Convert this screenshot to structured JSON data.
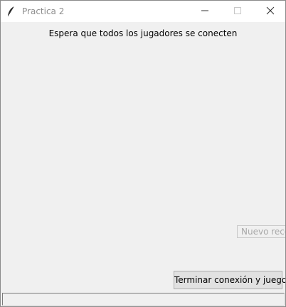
{
  "window": {
    "title": "Practica 2",
    "icons": {
      "app": "feather-icon",
      "minimize": "minimize-icon",
      "maximize": "maximize-icon",
      "close": "close-icon"
    }
  },
  "main": {
    "status_text": "Espera que todos los jugadores se conecten",
    "record_input_placeholder": "Nuevo recor",
    "end_button_label": "Terminar conexión y juego",
    "bottom_input_value": ""
  },
  "colors": {
    "background": "#f0f0f0",
    "titlebar": "#ffffff",
    "button_face": "#e1e1e1"
  }
}
